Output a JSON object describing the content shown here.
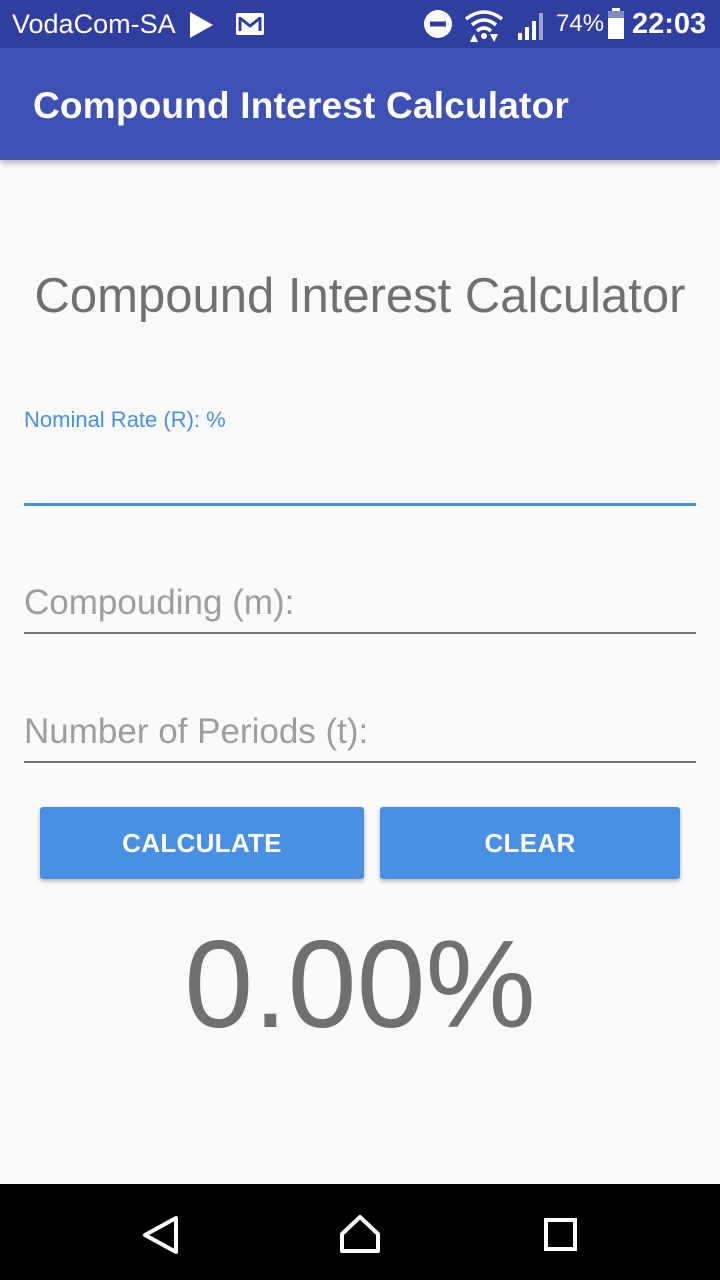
{
  "status_bar": {
    "carrier": "VodaCom-SA",
    "battery_percent": "74%",
    "time": "22:03",
    "icons": [
      "play-store-icon",
      "gmail-icon",
      "do-not-disturb-icon",
      "wifi-icon",
      "signal-icon",
      "battery-icon"
    ]
  },
  "app_bar": {
    "title": "Compound Interest Calculator"
  },
  "main": {
    "heading": "Compound Interest Calculator",
    "fields": {
      "nominal_rate": {
        "label": "Nominal Rate (R): %",
        "value": ""
      },
      "compounding": {
        "placeholder": "Compouding (m):",
        "value": ""
      },
      "periods": {
        "placeholder": "Number of Periods (t):",
        "value": ""
      }
    },
    "buttons": {
      "calculate": "CALCULATE",
      "clear": "CLEAR"
    },
    "result": "0.00%"
  },
  "nav_bar": {
    "icons": [
      "back-icon",
      "home-icon",
      "recents-icon"
    ]
  },
  "colors": {
    "status_bar": "#303f9f",
    "app_bar": "#3f51b5",
    "accent": "#4a90e2",
    "background": "#fafafa",
    "text_gray": "#707070",
    "nav_bar": "#000000"
  }
}
